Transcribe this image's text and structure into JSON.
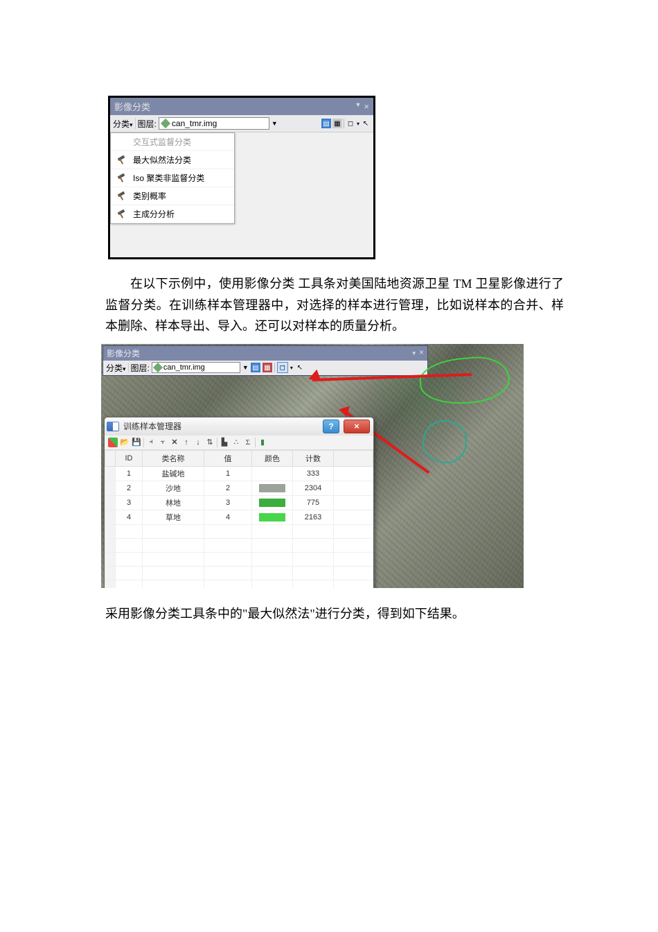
{
  "toolbar1": {
    "title": "影像分类",
    "classify_btn": "分类",
    "layer_label": "图层:",
    "layer_value": "can_tmr.img",
    "menu": {
      "item_interactive": "交互式监督分类",
      "item_ml": "最大似然法分类",
      "item_iso": "Iso 聚类非监督分类",
      "item_prob": "类别概率",
      "item_pca": "主成分分析"
    }
  },
  "para1": "在以下示例中，使用影像分类 工具条对美国陆地资源卫星 TM 卫星影像进行了监督分类。在训练样本管理器中，对选择的样本进行管理，比如说样本的合并、样本删除、样本导出、导入。还可以对样本的质量分析。",
  "toolbar2": {
    "title": "影像分类",
    "classify_btn": "分类",
    "layer_label": "图层:",
    "layer_value": "can_tmr.img"
  },
  "dialog": {
    "title": "训练样本管理器",
    "help": "?",
    "close": "×",
    "columns": {
      "id": "ID",
      "name": "类名称",
      "value": "值",
      "color": "颜色",
      "count": "计数"
    },
    "rows": [
      {
        "id": "1",
        "name": "盐碱地",
        "value": "1",
        "color": "",
        "count": "333"
      },
      {
        "id": "2",
        "name": "沙地",
        "value": "2",
        "color": "#9da39a",
        "count": "2304"
      },
      {
        "id": "3",
        "name": "林地",
        "value": "3",
        "color": "#3bae3b",
        "count": "775"
      },
      {
        "id": "4",
        "name": "草地",
        "value": "4",
        "color": "#49d549",
        "count": "2163"
      }
    ]
  },
  "para2": "采用影像分类工具条中的\"最大似然法\"进行分类，得到如下结果。",
  "chart_data": {
    "type": "table",
    "title": "训练样本管理器",
    "columns": [
      "ID",
      "类名称",
      "值",
      "颜色",
      "计数"
    ],
    "rows": [
      [
        1,
        "盐碱地",
        1,
        null,
        333
      ],
      [
        2,
        "沙地",
        2,
        "#9da39a",
        2304
      ],
      [
        3,
        "林地",
        3,
        "#3bae3b",
        775
      ],
      [
        4,
        "草地",
        4,
        "#49d549",
        2163
      ]
    ]
  }
}
